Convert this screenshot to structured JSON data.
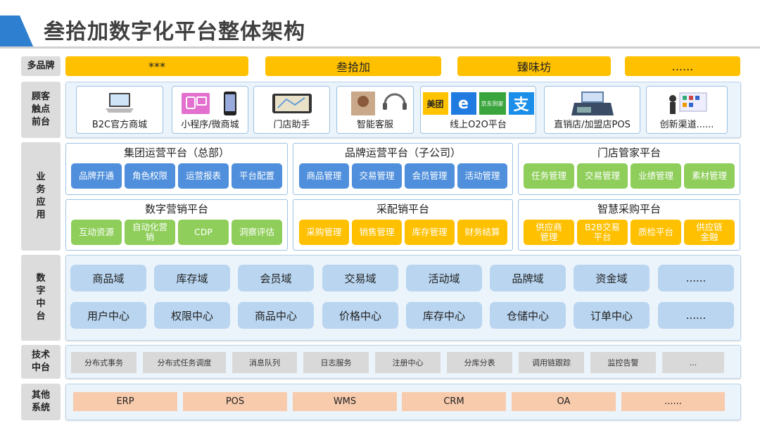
{
  "title": "叁拾加数字化平台整体架构",
  "colors": {
    "accent": "#2f7fd1",
    "brand": "#ffc000",
    "blue_chip": "#4f8fdc",
    "green_chip": "#8fce5a",
    "mid": "#b9d5f0",
    "other": "#f8cbad"
  },
  "rows": {
    "brand": "多品牌",
    "touch": "顾客触点前台",
    "biz": "业务应用",
    "mid": "数字中台",
    "tech": "技术中台",
    "other": "其他系统"
  },
  "brands": [
    "***",
    "叁拾加",
    "臻味坊",
    "......"
  ],
  "touchpoints": [
    {
      "label": "B2C官方商城",
      "icon": "laptop-icon"
    },
    {
      "label": "小程序/微商城",
      "icon": "devices-icon"
    },
    {
      "label": "门店助手",
      "icon": "tablet-map-icon"
    },
    {
      "label": "智能客服",
      "icon": "headset-icon"
    },
    {
      "label": "线上O2O平台",
      "icon": "o2o-logos-icon",
      "logos": [
        "美团",
        "e",
        "京东到家",
        "支"
      ]
    },
    {
      "label": "直销店/加盟店POS",
      "icon": "pos-icon"
    },
    {
      "label": "创新渠道......",
      "icon": "presentation-icon"
    }
  ],
  "groups": [
    {
      "title": "集团运营平台（总部）",
      "color": "blue",
      "items": [
        "品牌开通",
        "角色权限",
        "运营报表",
        "平台配置"
      ]
    },
    {
      "title": "品牌运营平台（子公司）",
      "color": "blue",
      "items": [
        "商品管理",
        "交易管理",
        "会员管理",
        "活动管理"
      ]
    },
    {
      "title": "门店管家平台",
      "color": "green",
      "items": [
        "任务管理",
        "交易管理",
        "业绩管理",
        "素材管理"
      ]
    },
    {
      "title": "数字营销平台",
      "color": "green",
      "items": [
        "互动资源",
        "自动化营销",
        "CDP",
        "洞察评估"
      ]
    },
    {
      "title": "采配销平台",
      "color": "orange",
      "items": [
        "采购管理",
        "销售管理",
        "库存管理",
        "财务结算"
      ]
    },
    {
      "title": "智慧采购平台",
      "color": "orange",
      "items": [
        "供应商管理",
        "B2B交易平台",
        "质检平台",
        "供应链金融"
      ]
    }
  ],
  "middle": {
    "row1": [
      "商品域",
      "库存域",
      "会员域",
      "交易域",
      "活动域",
      "品牌域",
      "资金域",
      "......"
    ],
    "row2": [
      "用户中心",
      "权限中心",
      "商品中心",
      "价格中心",
      "库存中心",
      "仓储中心",
      "订单中心",
      "......"
    ]
  },
  "tech": [
    "分布式事务",
    "分布式任务调度",
    "消息队列",
    "日志服务",
    "注册中心",
    "分库分表",
    "调用链跟踪",
    "监控告警",
    "..."
  ],
  "others": [
    "ERP",
    "POS",
    "WMS",
    "CRM",
    "OA",
    "......"
  ]
}
